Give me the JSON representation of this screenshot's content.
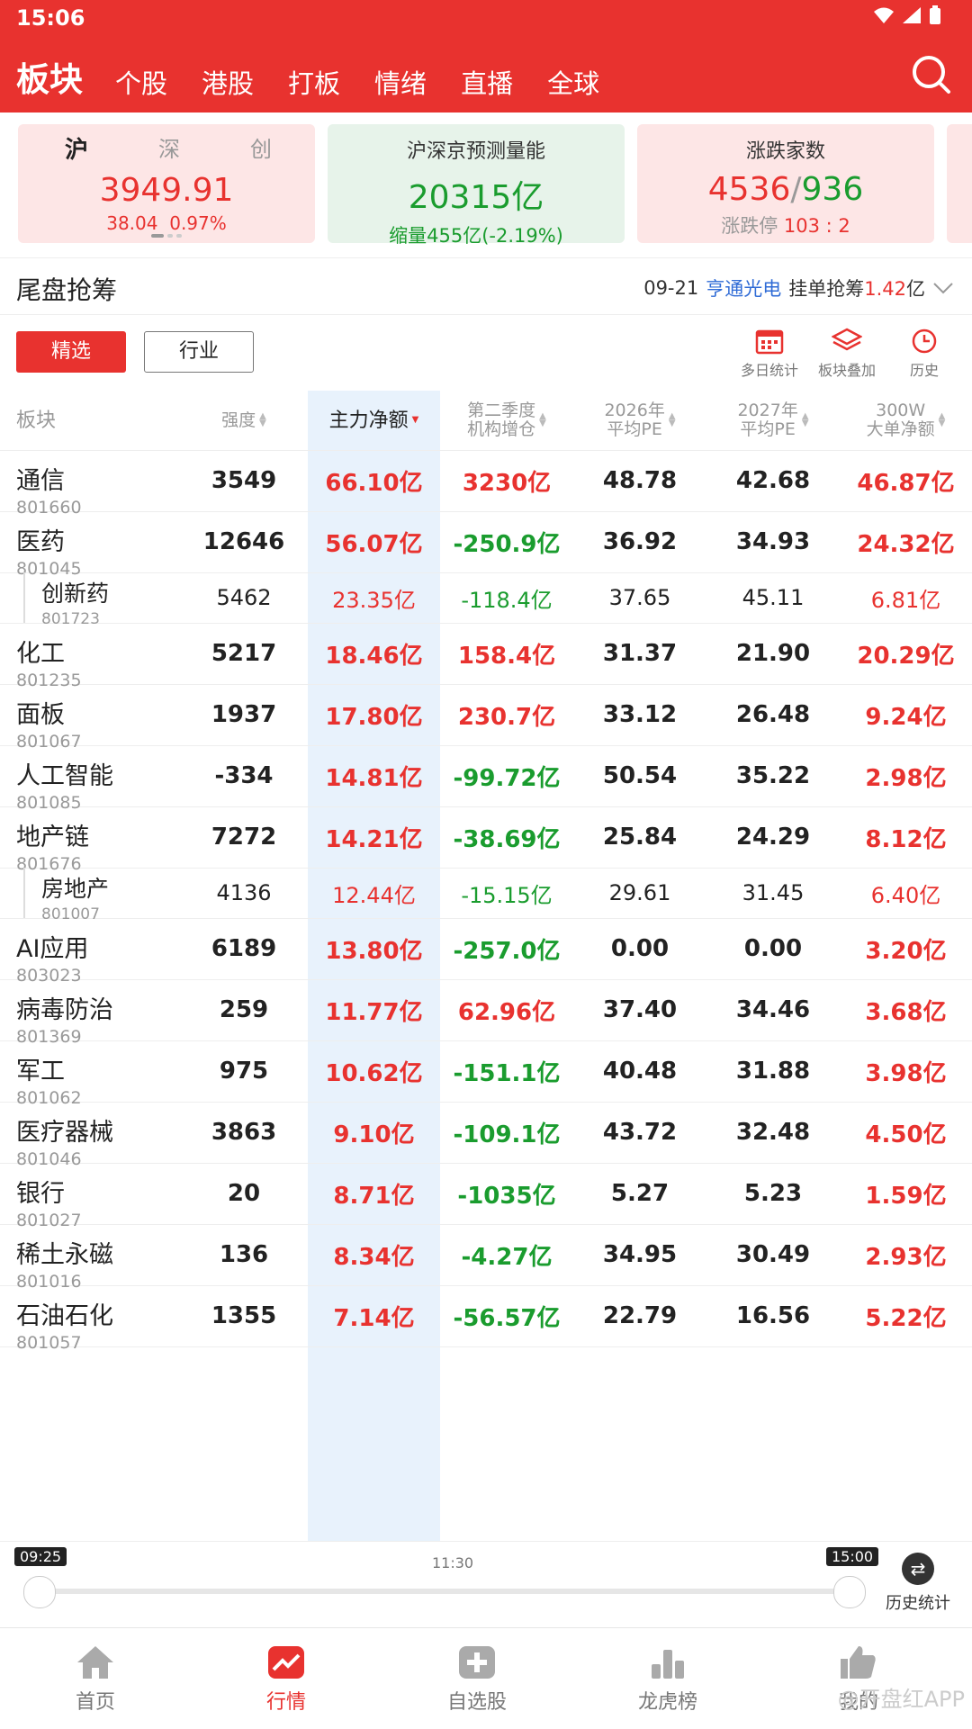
{
  "status": {
    "time": "15:06"
  },
  "nav": {
    "tabs": [
      "板块",
      "个股",
      "港股",
      "打板",
      "情绪",
      "直播",
      "全球"
    ]
  },
  "cards": {
    "index": {
      "tabs": [
        "沪",
        "深",
        "创"
      ],
      "value": "3949.91",
      "change": "38.04",
      "change_pct": "0.97%"
    },
    "volume": {
      "title": "沪深京预测量能",
      "value": "20315亿",
      "sub": "缩量455亿(-2.19%)"
    },
    "breadth": {
      "title": "涨跌家数",
      "up": "4536",
      "sep": "/",
      "down": "936",
      "sub_label": "涨跌停",
      "sub_val": "103 : 2"
    }
  },
  "section": {
    "title": "尾盘抢筹",
    "date": "09-21",
    "stock": "亨通光电",
    "label": "挂单抢筹",
    "amount": "1.42",
    "unit": "亿"
  },
  "filters": {
    "selected": "精选",
    "industry": "行业"
  },
  "tools": [
    "多日统计",
    "板块叠加",
    "历史"
  ],
  "headers": {
    "name": "板块",
    "strength": "强度",
    "net": "主力净额",
    "q2a": "第二季度",
    "q2b": "机构增仓",
    "pe26a": "2026年",
    "pe26b": "平均PE",
    "pe27a": "2027年",
    "pe27b": "平均PE",
    "big_a": "300W",
    "big_b": "大单净额"
  },
  "rows": [
    {
      "name": "通信",
      "code": "801660",
      "strength": "3549",
      "net": "66.10亿",
      "inst": "3230亿",
      "pe26": "48.78",
      "pe27": "42.68",
      "big": "46.87亿",
      "sub": false
    },
    {
      "name": "医药",
      "code": "801045",
      "strength": "12646",
      "net": "56.07亿",
      "inst": "-250.9亿",
      "pe26": "36.92",
      "pe27": "34.93",
      "big": "24.32亿",
      "sub": false
    },
    {
      "name": "创新药",
      "code": "801723",
      "strength": "5462",
      "net": "23.35亿",
      "inst": "-118.4亿",
      "pe26": "37.65",
      "pe27": "45.11",
      "big": "6.81亿",
      "sub": true
    },
    {
      "name": "化工",
      "code": "801235",
      "strength": "5217",
      "net": "18.46亿",
      "inst": "158.4亿",
      "pe26": "31.37",
      "pe27": "21.90",
      "big": "20.29亿",
      "sub": false
    },
    {
      "name": "面板",
      "code": "801067",
      "strength": "1937",
      "net": "17.80亿",
      "inst": "230.7亿",
      "pe26": "33.12",
      "pe27": "26.48",
      "big": "9.24亿",
      "sub": false
    },
    {
      "name": "人工智能",
      "code": "801085",
      "strength": "-334",
      "net": "14.81亿",
      "inst": "-99.72亿",
      "pe26": "50.54",
      "pe27": "35.22",
      "big": "2.98亿",
      "sub": false
    },
    {
      "name": "地产链",
      "code": "801676",
      "strength": "7272",
      "net": "14.21亿",
      "inst": "-38.69亿",
      "pe26": "25.84",
      "pe27": "24.29",
      "big": "8.12亿",
      "sub": false
    },
    {
      "name": "房地产",
      "code": "801007",
      "strength": "4136",
      "net": "12.44亿",
      "inst": "-15.15亿",
      "pe26": "29.61",
      "pe27": "31.45",
      "big": "6.40亿",
      "sub": true
    },
    {
      "name": "AI应用",
      "code": "803023",
      "strength": "6189",
      "net": "13.80亿",
      "inst": "-257.0亿",
      "pe26": "0.00",
      "pe27": "0.00",
      "big": "3.20亿",
      "sub": false
    },
    {
      "name": "病毒防治",
      "code": "801369",
      "strength": "259",
      "net": "11.77亿",
      "inst": "62.96亿",
      "pe26": "37.40",
      "pe27": "34.46",
      "big": "3.68亿",
      "sub": false
    },
    {
      "name": "军工",
      "code": "801062",
      "strength": "975",
      "net": "10.62亿",
      "inst": "-151.1亿",
      "pe26": "40.48",
      "pe27": "31.88",
      "big": "3.98亿",
      "sub": false
    },
    {
      "name": "医疗器械",
      "code": "801046",
      "strength": "3863",
      "net": "9.10亿",
      "inst": "-109.1亿",
      "pe26": "43.72",
      "pe27": "32.48",
      "big": "4.50亿",
      "sub": false
    },
    {
      "name": "银行",
      "code": "801027",
      "strength": "20",
      "net": "8.71亿",
      "inst": "-1035亿",
      "pe26": "5.27",
      "pe27": "5.23",
      "big": "1.59亿",
      "sub": false
    },
    {
      "name": "稀土永磁",
      "code": "801016",
      "strength": "136",
      "net": "8.34亿",
      "inst": "-4.27亿",
      "pe26": "34.95",
      "pe27": "30.49",
      "big": "2.93亿",
      "sub": false
    },
    {
      "name": "石油石化",
      "code": "801057",
      "strength": "1355",
      "net": "7.14亿",
      "inst": "-56.57亿",
      "pe26": "22.79",
      "pe27": "16.56",
      "big": "5.22亿",
      "sub": false
    }
  ],
  "timeline": {
    "start": "09:25",
    "mid": "11:30",
    "end": "15:00",
    "hist": "历史统计"
  },
  "bottom_nav": [
    "首页",
    "行情",
    "自选股",
    "龙虎榜",
    "我的"
  ],
  "watermark": "@开盘红APP",
  "colors": {
    "brand_red": "#e8322f",
    "up": "#e8322f",
    "down": "#1a9c2e",
    "highlight": "#e8f2fc"
  }
}
